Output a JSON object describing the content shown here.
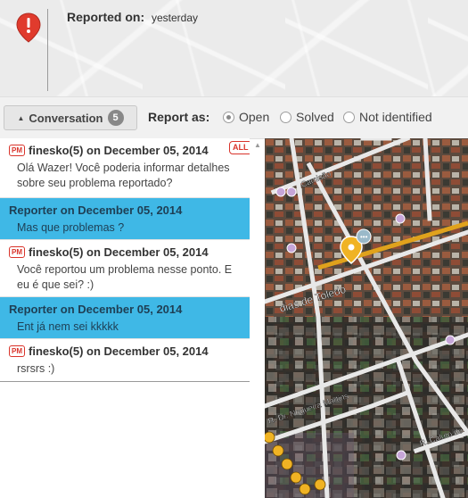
{
  "header": {
    "reported_label": "Reported on:",
    "reported_value": "yesterday",
    "icon": "alert-pin-icon"
  },
  "toolbar": {
    "conversation_label": "Conversation",
    "conversation_count": "5",
    "report_as_label": "Report as:",
    "options": [
      "Open",
      "Solved",
      "Not identified"
    ],
    "selected": "Open"
  },
  "conversation": {
    "all_badge": "ALL",
    "messages": [
      {
        "author": "finesko(5) on December 05, 2014",
        "text": "Olá Wazer! Você poderia informar detalhes sobre seu problema reportado?",
        "pm": "PM"
      },
      {
        "author": "Reporter on December 05, 2014",
        "text": "Mas que problemas ?"
      },
      {
        "author": "finesko(5) on December 05, 2014",
        "text": "Você reportou um problema nesse ponto. E eu é que sei? :)",
        "pm": "PM"
      },
      {
        "author": "Reporter on December 05, 2014",
        "text": "Ent já nem sei kkkkk"
      },
      {
        "author": "finesko(5) on December 05, 2014",
        "text": "rsrsrs :)",
        "pm": "PM"
      }
    ]
  },
  "map": {
    "streets": [
      "Camisão",
      "dias de Toledo",
      "R. Dr. Nogueira Martins",
      "R. Caluto de"
    ],
    "colors": {
      "road_highlight": "#e0a21c",
      "waypoint": "#c6a6d8",
      "alert_marker": "#f0b324",
      "road": "#e8e8e8"
    }
  }
}
